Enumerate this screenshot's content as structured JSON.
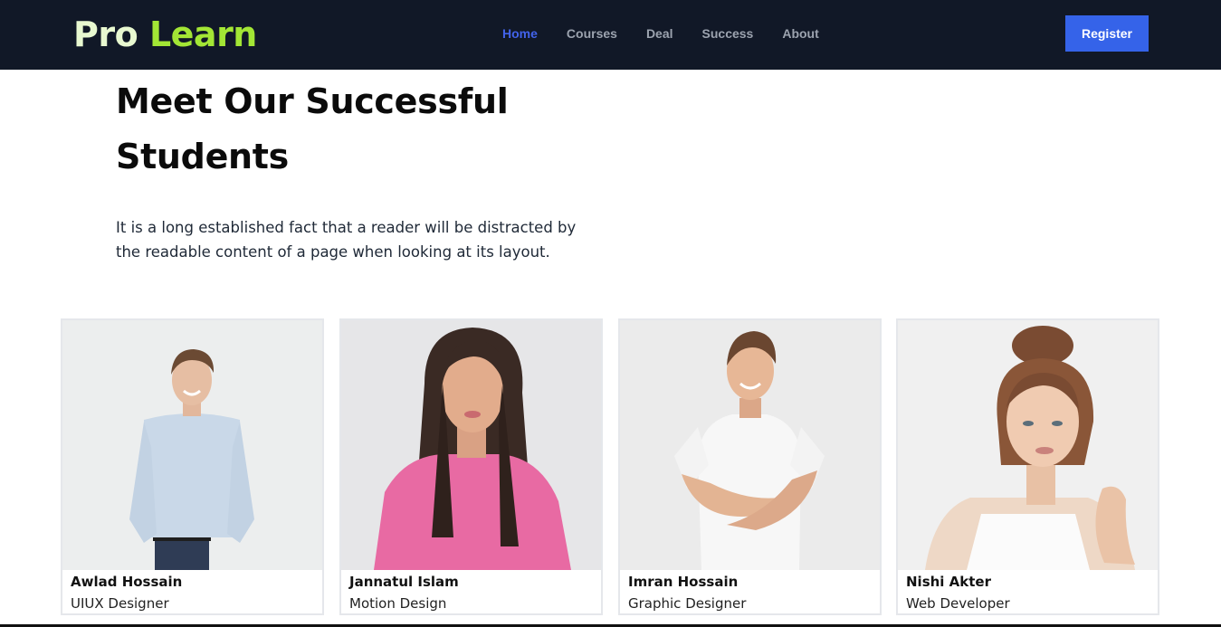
{
  "brand": {
    "first": "Pro",
    "second": "Learn"
  },
  "nav": {
    "items": [
      {
        "label": "Home",
        "active": true
      },
      {
        "label": "Courses",
        "active": false
      },
      {
        "label": "Deal",
        "active": false
      },
      {
        "label": "Success",
        "active": false
      },
      {
        "label": "About",
        "active": false
      }
    ],
    "register_label": "Register"
  },
  "hero": {
    "title_line1": "Meet Our Successful",
    "title_line2": "Students",
    "description": "It is a long established fact that a reader will be distracted by the readable content of a page when looking at its layout."
  },
  "students": [
    {
      "name": "Awlad Hossain",
      "role": "UIUX Designer"
    },
    {
      "name": "Jannatul Islam",
      "role": "Motion Design"
    },
    {
      "name": "Imran Hossain",
      "role": "Graphic Designer"
    },
    {
      "name": "Nishi Akter",
      "role": "Web Developer"
    }
  ],
  "colors": {
    "navbar_bg": "#111827",
    "brand_accent": "#a3e635",
    "nav_active": "#4263eb",
    "register_bg": "#3563e9"
  }
}
